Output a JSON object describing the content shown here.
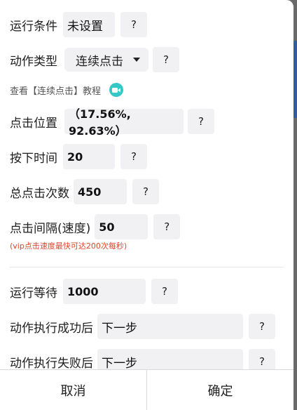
{
  "form": {
    "run_condition": {
      "label": "运行条件",
      "value": "未设置"
    },
    "action_type": {
      "label": "动作类型",
      "value": "连续点击"
    },
    "tutorial_link": "查看【连续点击】教程",
    "click_position": {
      "label": "点击位置",
      "value": "（17.56%, 92.63%）"
    },
    "press_time": {
      "label": "按下时间",
      "value": "20"
    },
    "total_clicks": {
      "label": "总点击次数",
      "value": "450"
    },
    "click_interval": {
      "label": "点击间隔(速度)",
      "value": "50"
    },
    "vip_note": "(vip点击速度最快可达200次每秒)",
    "run_wait": {
      "label": "运行等待",
      "value": "1000"
    },
    "on_success": {
      "label": "动作执行成功后",
      "value": "下一步"
    },
    "on_failure": {
      "label": "动作执行失败后",
      "value": "下一步"
    },
    "help_label": "?"
  },
  "footer": {
    "cancel_label": "取消",
    "confirm_label": "确定"
  },
  "colors": {
    "accent_teal": "#38c7c7",
    "note_red": "#e0452b"
  },
  "icons": {
    "video": "video-camera-icon",
    "dropdown": "caret-down-icon"
  }
}
